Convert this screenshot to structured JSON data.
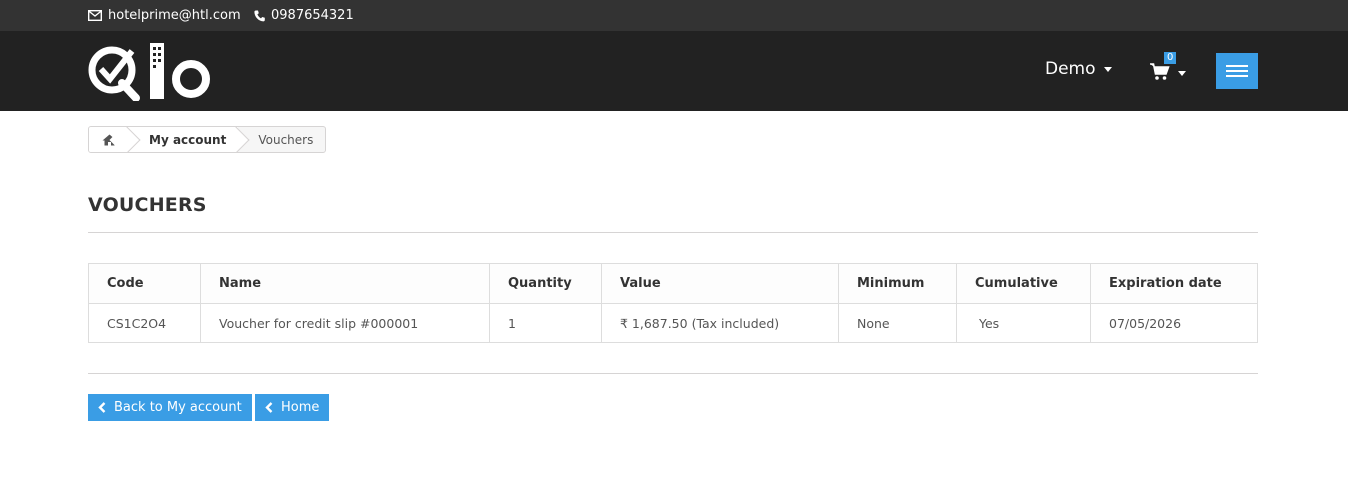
{
  "topbar": {
    "email": "hotelprime@htl.com",
    "phone": "0987654321"
  },
  "header": {
    "user_label": "Demo",
    "cart_count": "0"
  },
  "breadcrumb": {
    "items": [
      "My account",
      "Vouchers"
    ]
  },
  "page": {
    "title": "VOUCHERS"
  },
  "table": {
    "headers": [
      "Code",
      "Name",
      "Quantity",
      "Value",
      "Minimum",
      "Cumulative",
      "Expiration date"
    ],
    "rows": [
      [
        "CS1C2O4",
        "Voucher for credit slip #000001",
        "1",
        "₹ 1,687.50 (Tax included)",
        "None",
        "Yes",
        "07/05/2026"
      ]
    ]
  },
  "buttons": {
    "back_label": "Back to My account",
    "home_label": "Home"
  },
  "colors": {
    "accent": "#3a9de5",
    "header_bg": "#222222",
    "topbar_bg": "#333333"
  },
  "icons": [
    "envelope-icon",
    "phone-icon",
    "home-icon",
    "cart-icon",
    "hamburger-icon",
    "chevron-left-icon"
  ]
}
